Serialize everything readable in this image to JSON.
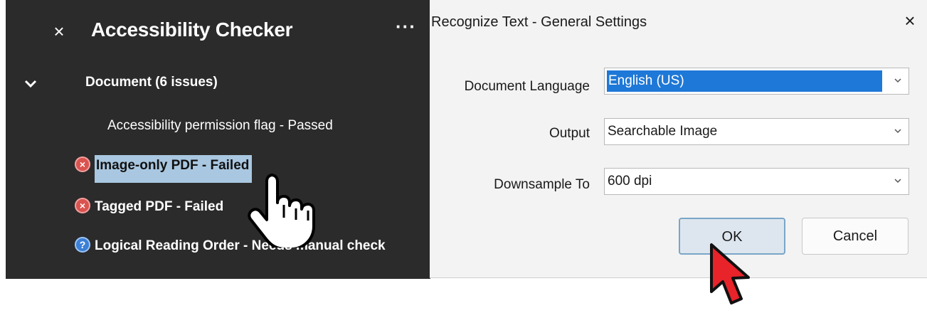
{
  "panel": {
    "close_glyph": "×",
    "title": "Accessibility Checker",
    "more_glyph": "···",
    "section": "Document (6 issues)",
    "items": [
      {
        "label": "Accessibility permission flag - Passed",
        "status": "passed"
      },
      {
        "label": "Image-only PDF - Failed",
        "status": "failed",
        "selected": true,
        "icon": "fail-icon"
      },
      {
        "label": "Tagged PDF - Failed",
        "status": "failed",
        "icon": "fail-icon"
      },
      {
        "label": "Logical Reading Order - Needs manual check",
        "status": "manual",
        "icon": "question-icon"
      }
    ],
    "highlight_color": "#a9c7e0"
  },
  "dialog": {
    "title": "Recognize Text - General Settings",
    "close_glyph": "×",
    "fields": [
      {
        "label": "Document Language",
        "value": "English (US)"
      },
      {
        "label": "Output",
        "value": "Searchable Image"
      },
      {
        "label": "Downsample To",
        "value": "600 dpi"
      }
    ],
    "ok_label": "OK",
    "cancel_label": "Cancel",
    "accent": "#1e78d7"
  },
  "icons": {
    "fail_glyph": "×",
    "question_glyph": "?"
  }
}
